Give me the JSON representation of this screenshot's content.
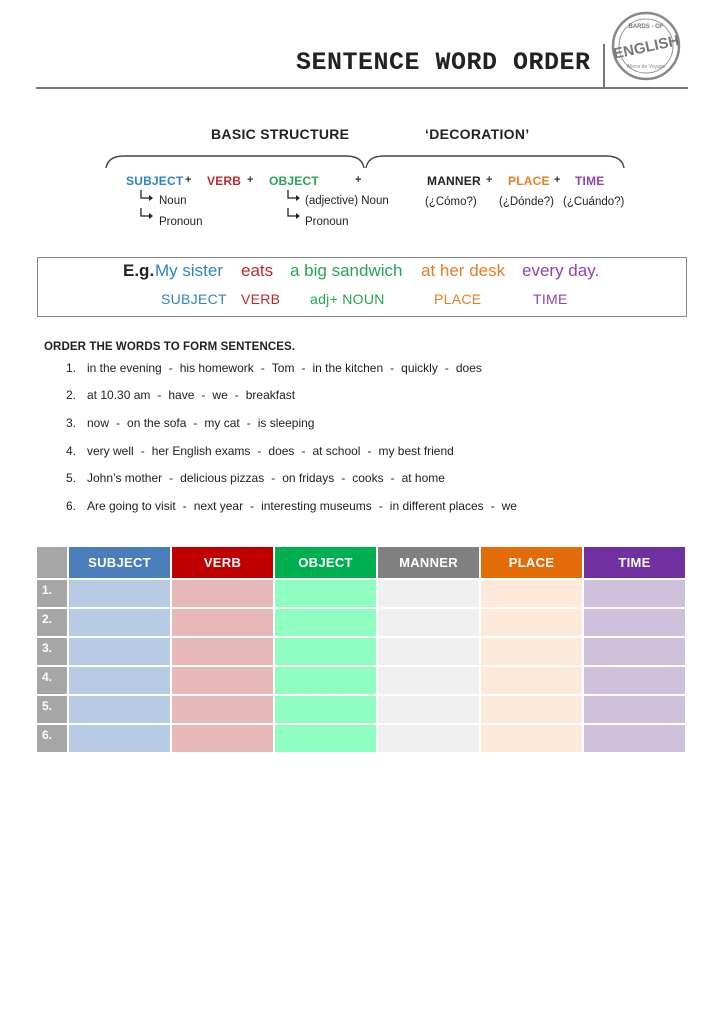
{
  "header": {
    "title": "SENTENCE WORD ORDER",
    "logo": {
      "top_text": "BARDS - OF",
      "main_text": "ENGLISH",
      "bottom_text": "Aliens de Voyage"
    }
  },
  "structure": {
    "basic_heading": "BASIC STRUCTURE",
    "decoration_heading": "‘DECORATION’",
    "plus": "+",
    "basic": [
      {
        "label": "SUBJECT",
        "color": "#2e86c1",
        "subs": [
          "Noun",
          "Pronoun"
        ]
      },
      {
        "label": "VERB",
        "color": "#c0272d",
        "subs": []
      },
      {
        "label": "OBJECT",
        "color": "#27a455",
        "subs": [
          "(adjective) Noun",
          "Pronoun"
        ]
      }
    ],
    "decoration": [
      {
        "label": "MANNER",
        "color": "#222222",
        "question": "(¿Cómo?)"
      },
      {
        "label": "PLACE",
        "color": "#e67e22",
        "question": "(¿Dónde?)"
      },
      {
        "label": "TIME",
        "color": "#8e44ad",
        "question": "(¿Cuándo?)"
      }
    ]
  },
  "example": {
    "prefix": "E.g.",
    "parts": [
      {
        "text": "My sister",
        "label": "SUBJECT",
        "color": "#2e86c1"
      },
      {
        "text": "eats",
        "label": "VERB",
        "color": "#c0272d"
      },
      {
        "text": "a big sandwich",
        "label": "adj+ NOUN",
        "color": "#27a455"
      },
      {
        "text": "at her desk",
        "label": "PLACE",
        "color": "#e67e22"
      },
      {
        "text": "every day.",
        "label": "TIME",
        "color": "#8e44ad"
      }
    ]
  },
  "exercise": {
    "instruction": "ORDER THE WORDS TO FORM SENTENCES.",
    "items": [
      {
        "num": "1.",
        "words": [
          "in the evening",
          "his homework",
          "Tom",
          "in the kitchen",
          "quickly",
          "does"
        ]
      },
      {
        "num": "2.",
        "words": [
          "at 10.30 am",
          "have",
          "we",
          "breakfast"
        ]
      },
      {
        "num": "3.",
        "words": [
          "now",
          "on the sofa",
          "my cat",
          "is sleeping"
        ]
      },
      {
        "num": "4.",
        "words": [
          "very well",
          "her English exams",
          "does",
          "at school",
          "my best friend"
        ]
      },
      {
        "num": "5.",
        "words": [
          "John’s mother",
          "delicious pizzas",
          "on fridays",
          "cooks",
          "at home"
        ]
      },
      {
        "num": "6.",
        "words": [
          "Are going to visit",
          "next year",
          "interesting museums",
          "in different places",
          "we"
        ]
      }
    ]
  },
  "table": {
    "columns": [
      {
        "label": "SUBJECT",
        "header_color": "#4a7ebb",
        "fill": "#b7cce4"
      },
      {
        "label": "VERB",
        "header_color": "#c00000",
        "fill": "#e6b8b7"
      },
      {
        "label": "OBJECT",
        "header_color": "#00b050",
        "fill": "#8ffcc0"
      },
      {
        "label": "MANNER",
        "header_color": "#808080",
        "fill": "#f0f0f0"
      },
      {
        "label": "PLACE",
        "header_color": "#e36c0a",
        "fill": "#fde9d9"
      },
      {
        "label": "TIME",
        "header_color": "#7030a0",
        "fill": "#ccc0da"
      }
    ],
    "rows": [
      "1.",
      "2.",
      "3.",
      "4.",
      "5.",
      "6."
    ]
  }
}
